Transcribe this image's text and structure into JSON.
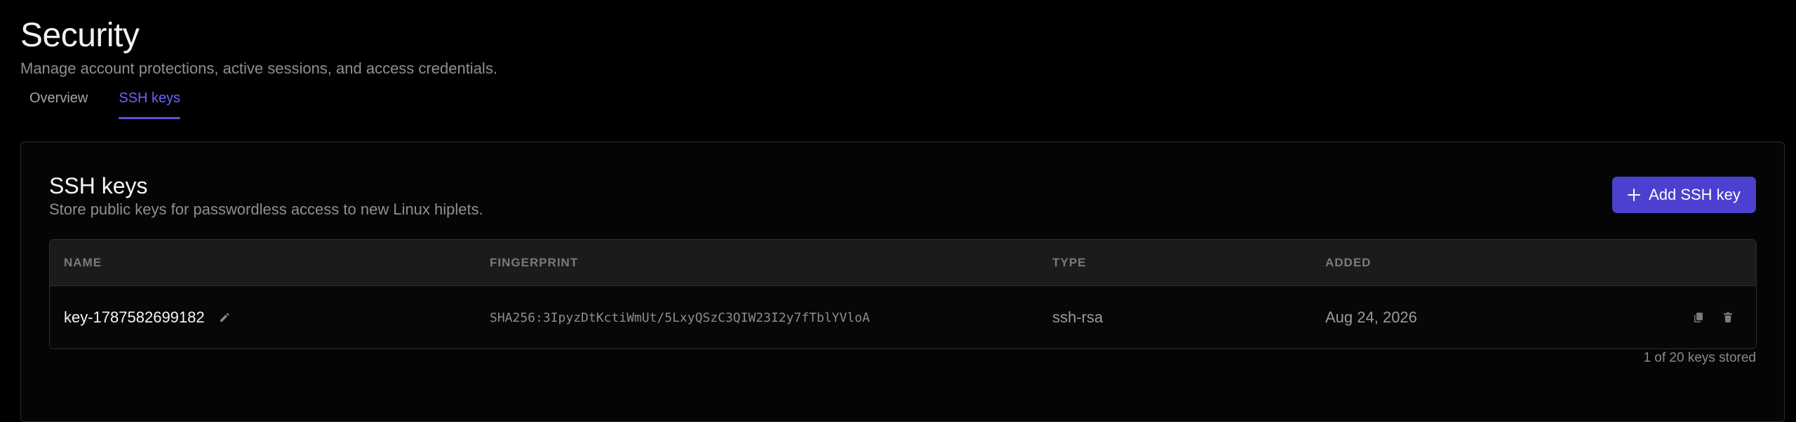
{
  "page": {
    "title": "Security",
    "subtitle": "Manage account protections, active sessions, and access credentials."
  },
  "tabs": [
    {
      "label": "Overview",
      "active": false
    },
    {
      "label": "SSH keys",
      "active": true
    }
  ],
  "card": {
    "title": "SSH keys",
    "subtitle": "Store public keys for passwordless access to new Linux hiplets.",
    "add_button_label": "Add SSH key"
  },
  "table": {
    "columns": [
      "NAME",
      "FINGERPRINT",
      "TYPE",
      "ADDED"
    ],
    "rows": [
      {
        "name": "key-1787582699182",
        "fingerprint": "SHA256:3IpyzDtKctiWmUt/5LxyQSzC3QIW23I2y7fTblYVloA",
        "type": "ssh-rsa",
        "added": "Aug 24, 2026"
      }
    ]
  },
  "footer": {
    "count_text": "1 of 20 keys stored"
  },
  "colors": {
    "accent": "#4b40cf",
    "active_tab": "#6c63ff",
    "background": "#000000"
  },
  "icons": {
    "edit": "pencil-icon",
    "copy": "copy-icon",
    "delete": "trash-icon",
    "add": "plus-icon"
  }
}
